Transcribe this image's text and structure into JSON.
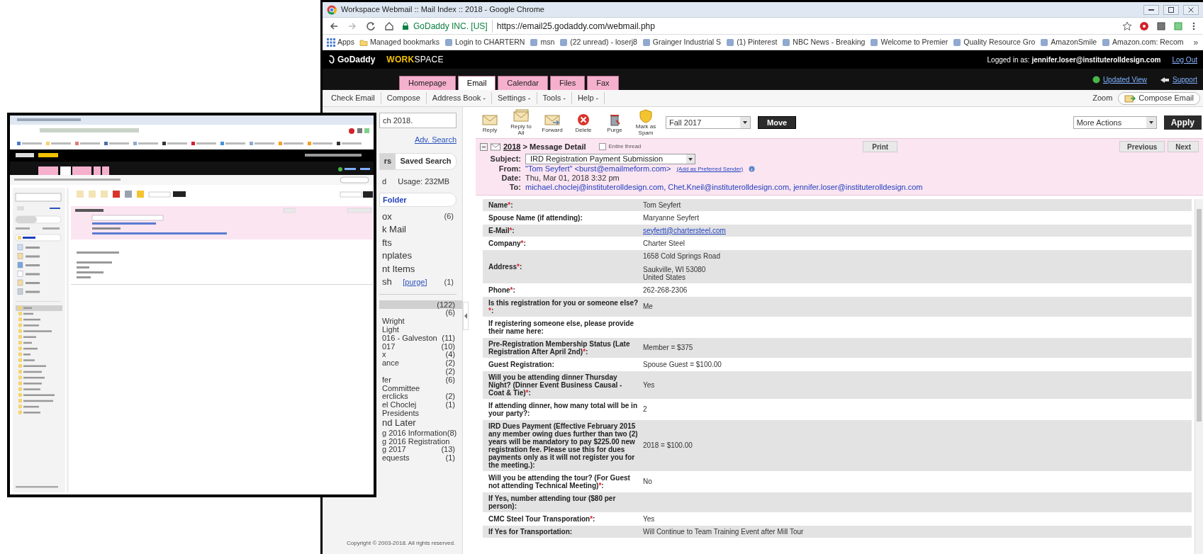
{
  "background_window": {
    "title": "Workspace Webmail :: Mail Index :: 2018 - Google Chrome",
    "site_identity": "GoDaddy INC. [US]",
    "url": "https://email25.godaddy.com/webmail.php",
    "bookmarks": [
      {
        "label": "Apps",
        "kind": "apps"
      },
      {
        "label": "Managed bookmarks",
        "kind": "folder"
      },
      {
        "label": "Login to CHARTERN",
        "kind": "page"
      },
      {
        "label": "msn",
        "kind": "page"
      },
      {
        "label": "(22 unread) - loserj8",
        "kind": "page"
      },
      {
        "label": "Grainger Industrial S",
        "kind": "page"
      },
      {
        "label": "(1) Pinterest",
        "kind": "page"
      },
      {
        "label": "NBC News - Breaking",
        "kind": "page"
      },
      {
        "label": "Welcome to Premier",
        "kind": "page"
      },
      {
        "label": "Quality Resource Gro",
        "kind": "page"
      },
      {
        "label": "AmazonSmile",
        "kind": "page"
      },
      {
        "label": "Amazon.com: Recom",
        "kind": "page"
      }
    ],
    "bookmarks_overflow": "»",
    "brand": "GoDaddy",
    "product": "WORKSPACE",
    "login_status": "Logged in as: **jennifer.loser@instituterolldesign.com**",
    "logout": "Log Out",
    "tabs": [
      {
        "label": "Homepage",
        "selected": false
      },
      {
        "label": "Email",
        "selected": true
      },
      {
        "label": "Calendar",
        "selected": false
      },
      {
        "label": "Files",
        "selected": false
      },
      {
        "label": "Fax",
        "selected": false
      }
    ],
    "updated_view": "Updated View",
    "support": "Support",
    "menu": [
      "Check Email",
      "Compose",
      "Address Book -",
      "Settings -",
      "Tools -",
      "Help -"
    ],
    "zoom": "Zoom",
    "compose_email": "Compose Email",
    "sidebar": {
      "search_value": "ch 2018.",
      "adv_search": "Adv. Search",
      "folder_tabs": [
        {
          "label": "rs",
          "selected": true
        },
        {
          "label": "Saved Search",
          "selected": false
        }
      ],
      "quota": "d",
      "usage": "Usage: 232MB",
      "new_folder": "Folder",
      "system_folders": [
        {
          "name": "ox",
          "count": "(6)"
        },
        {
          "name": "k Mail"
        },
        {
          "name": "fts"
        },
        {
          "name": "nplates"
        },
        {
          "name": "nt Items"
        },
        {
          "name": "sh",
          "purge": "[purge]",
          "count": "(1)"
        }
      ],
      "folders": [
        {
          "count": "(122)",
          "selected": true,
          "kind": "folder"
        },
        {
          "count": "(6)",
          "selected": false,
          "kind": "folder"
        },
        {
          "name": "Wright",
          "selected": false,
          "kind": "folder"
        },
        {
          "name": "Light",
          "selected": false,
          "kind": "folder"
        },
        {
          "name": "016 - Galveston",
          "count": "(11)",
          "selected": false,
          "kind": "folder"
        },
        {
          "name": "017",
          "count": "(10)",
          "selected": false,
          "kind": "folder"
        },
        {
          "name": "x",
          "count": "(4)",
          "selected": false,
          "kind": "folder"
        },
        {
          "name": "ance",
          "count": "(2)",
          "selected": false,
          "kind": "folder"
        },
        {
          "count": "(2)",
          "selected": false,
          "kind": "folder"
        },
        {
          "name": "fer",
          "count": "(6)",
          "selected": false,
          "kind": "folder"
        },
        {
          "name": "Committee",
          "selected": false,
          "kind": "folder"
        },
        {
          "name": "erclicks",
          "count": "(2)",
          "selected": false,
          "kind": "folder"
        },
        {
          "name": "el Choclej",
          "count": "(1)",
          "selected": false,
          "kind": "folder"
        },
        {
          "name": "Presidents",
          "selected": false,
          "kind": "folder"
        },
        {
          "name": "nd Later",
          "selected": false,
          "kind": "special"
        },
        {
          "name": "g 2016 Information",
          "count": "(8)",
          "selected": false,
          "kind": "folder"
        },
        {
          "name": "g 2016 Registration",
          "selected": false,
          "kind": "folder"
        },
        {
          "name": "g 2017",
          "count": "(13)",
          "selected": false,
          "kind": "folder"
        },
        {
          "name": "equests",
          "count": "(1)",
          "selected": false,
          "kind": "folder"
        }
      ],
      "copyright": "Copyright © 2003-2018. All rights reserved."
    },
    "toolbar": {
      "buttons": [
        {
          "label": "Reply",
          "kind": "reply"
        },
        {
          "label": "Reply to All",
          "kind": "reply_all"
        },
        {
          "label": "Forward",
          "kind": "forward"
        },
        {
          "label": "Delete",
          "kind": "delete"
        },
        {
          "label": "Purge",
          "kind": "purge"
        },
        {
          "label": "Mark as Spam",
          "kind": "spam"
        }
      ],
      "move_folder": "Fall 2017",
      "move": "Move",
      "more_actions": "More Actions",
      "apply": "Apply"
    },
    "message": {
      "folder_link": "2018",
      "title": " > Message Detail",
      "entire_thread": {
        "label": "Entire thread",
        "checked": false
      },
      "print": "Print",
      "previous": "Previous",
      "next": "Next",
      "subject_label": "Subject:",
      "subject": "IRD Registration Payment Submission",
      "from_label": "From:",
      "from": "\"Tom Seyfert\" <burst@emailmeform.com>",
      "add_sender": "(Add as Preferred Sender)",
      "date_label": "Date:",
      "date": "Thu, Mar 01, 2018 3:32 pm",
      "to_label": "To:",
      "to": "michael.choclej@instituterolldesign.com, Chet.Kneil@instituterolldesign.com, jennifer.loser@instituterolldesign.com"
    },
    "form_rows": [
      {
        "label": "Name",
        "asterisk": "*",
        "end": ":",
        "value": "Tom Seyfert"
      },
      {
        "label": "Spouse Name (if attending):",
        "value": "Maryanne Seyfert"
      },
      {
        "label": "E-Mail",
        "asterisk": "*",
        "end": ":",
        "value": "seyfertt@chartersteel.com",
        "kind": "link"
      },
      {
        "label": "Company",
        "asterisk": "*",
        "end": ":",
        "value": "Charter Steel"
      },
      {
        "label": "Address",
        "asterisk": "*",
        "end": ":",
        "value_lines": [
          "1658 Cold Springs Road",
          "Saukville, WI 53080",
          "United States"
        ]
      },
      {
        "label": "Phone",
        "asterisk": "*",
        "end": ":",
        "value": "262-268-2306"
      },
      {
        "label": "Is this registration for you or someone else? ",
        "asterisk": "*",
        "end": ":",
        "value": "Me"
      },
      {
        "label": "If registering someone else, please provide their name here:"
      },
      {
        "label": "Pre-Registration Membership Status (Late Registration After April 2nd)",
        "asterisk": "*",
        "end": ":",
        "value": "Member = $375"
      },
      {
        "label": "Guest Registration:",
        "value": "Spouse Guest = $100.00"
      },
      {
        "label": "Will you be attending dinner Thursday Night? (Dinner Event Business Causal - Coat & Tie)",
        "asterisk": "*",
        "end": ":",
        "value": "Yes"
      },
      {
        "label": "If attending dinner, how many total will be in your party?:",
        "value": "2"
      },
      {
        "label": "IRD Dues Payment (Effective February 2015 any member owing dues further than two (2) years will be mandatory to pay $225.00 new registration fee. Please use this for dues payments only as it will not register you for the meeting.):",
        "value": "2018 = $100.00"
      },
      {
        "label": "Will you be attending the tour? (For Guest not attending Technical Meeting)",
        "asterisk": "*",
        "end": ":",
        "value": "No"
      },
      {
        "label": "If Yes, number attending tour ($80 per person):"
      },
      {
        "label": "CMC Steel Tour Transporation",
        "asterisk": "*",
        "end": ":",
        "value": "Yes"
      },
      {
        "label": "If Yes for Transportation:",
        "value": "Will Continue to Team Training Event after Mill Tour"
      }
    ]
  }
}
